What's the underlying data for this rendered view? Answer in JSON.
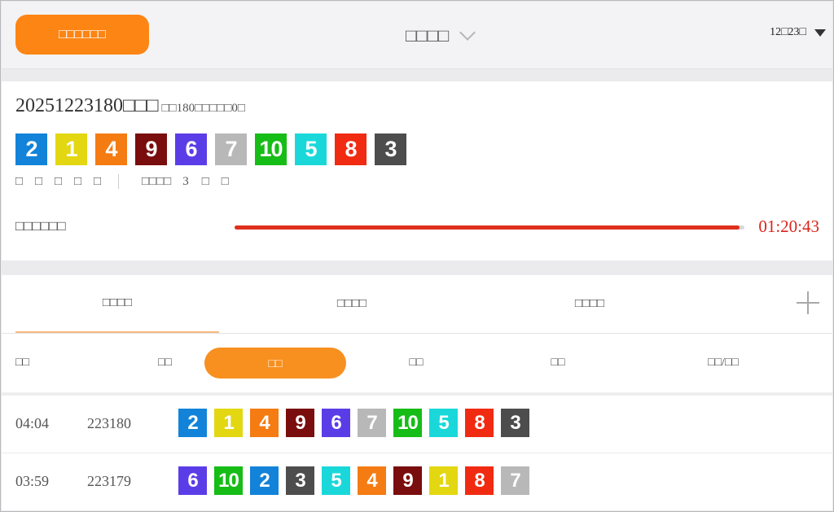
{
  "header": {
    "left_button_label": "□□□□□□",
    "title": "□□□□",
    "date_label": "12□23□"
  },
  "colors": {
    "accent": "#fd8514",
    "segment_active": "#f7901f",
    "countdown": "#d9251c",
    "progress": "#e0301e",
    "ball": {
      "1": "#e3d712",
      "2": "#1283d9",
      "3": "#4d4d4d",
      "4": "#f57b13",
      "5": "#1ad8da",
      "6": "#5b3de8",
      "7": "#b8b8b8",
      "8": "#f02b12",
      "9": "#7a0d0d",
      "10": "#16bd17"
    }
  },
  "latest": {
    "issue": "20251223180□□□",
    "sub": "□□180□□□□□0□",
    "numbers": [
      "2",
      "1",
      "4",
      "9",
      "6",
      "7",
      "10",
      "5",
      "8",
      "3"
    ],
    "stats_cells": [
      "□",
      "□",
      "□",
      "□",
      "□"
    ],
    "stats_label": "□□□□",
    "stats_number": "3",
    "stats_tail": [
      "□",
      "□"
    ]
  },
  "countdown": {
    "label": "□□□□□□",
    "time": "01:20:43",
    "progress": 0.99
  },
  "tabs": [
    {
      "label": "□□□□"
    },
    {
      "label": "□□□□"
    },
    {
      "label": "□□□□"
    }
  ],
  "subheader": {
    "col_time": "□□",
    "col_issue": "□□",
    "seg_active": "□□",
    "seg_2": "□□",
    "seg_3": "□□",
    "seg_4": "□□/□□"
  },
  "rows": [
    {
      "time": "04:04",
      "issue": "223180",
      "numbers": [
        "2",
        "1",
        "4",
        "9",
        "6",
        "7",
        "10",
        "5",
        "8",
        "3"
      ]
    },
    {
      "time": "03:59",
      "issue": "223179",
      "numbers": [
        "6",
        "10",
        "2",
        "3",
        "5",
        "4",
        "9",
        "1",
        "8",
        "7"
      ]
    }
  ]
}
